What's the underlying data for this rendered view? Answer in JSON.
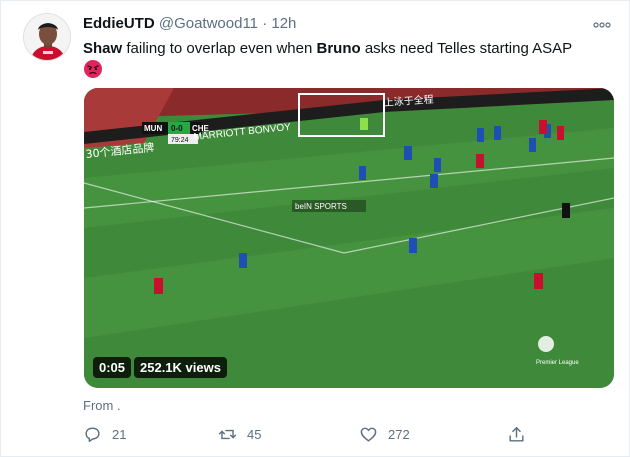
{
  "tweet": {
    "display_name": "EddieUTD",
    "handle": "@Goatwood11",
    "separator": "·",
    "time": "12h",
    "more_icon": "more-dots-icon",
    "text_bold_1": "Shaw",
    "text_1": " failing to overlap even when ",
    "text_bold_2": "Bruno",
    "text_2": " asks need Telles starting ASAP",
    "emoji": "angry-face-emoji"
  },
  "video": {
    "scoreboard": {
      "home": "MUN",
      "score": "0-0",
      "away": "CHE",
      "clock": "79:24"
    },
    "broadcaster": "beIN SPORTS",
    "ad_text": "MARRIOTT BONVOY",
    "ad_text_cn": "30个酒店品牌",
    "ad_text_cn_top": "上泳于全程",
    "league_logo": "Premier League",
    "duration": "0:05",
    "views": "252.1K views"
  },
  "from_label": "From .",
  "actions": {
    "reply_count": "21",
    "retweet_count": "45",
    "like_count": "272",
    "reply_icon": "reply-icon",
    "retweet_icon": "retweet-icon",
    "like_icon": "heart-icon",
    "share_icon": "share-icon"
  },
  "colors": {
    "text_secondary": "#5b7083",
    "pitch_green": "#3f8a3a",
    "chelsea_blue": "#1e4fb5",
    "united_red": "#c8102e"
  }
}
